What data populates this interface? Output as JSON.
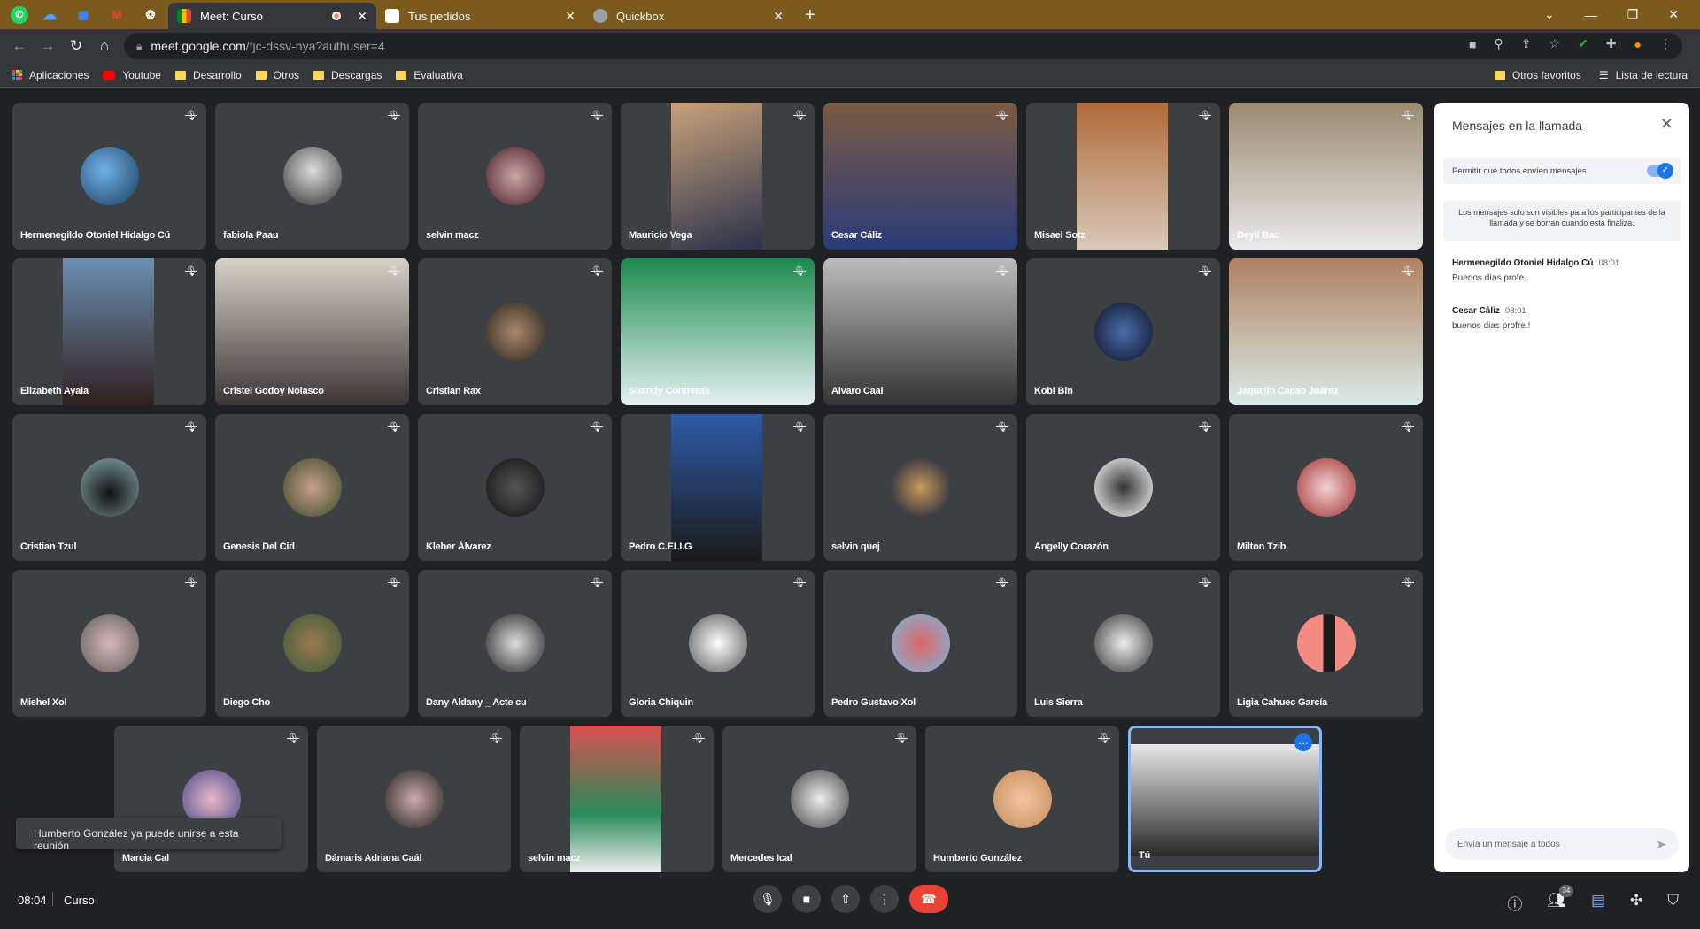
{
  "browser": {
    "tabs": [
      {
        "label": "Meet: Curso",
        "active": true,
        "recording": true
      },
      {
        "label": "Tus pedidos",
        "active": false
      },
      {
        "label": "Quickbox",
        "active": false
      }
    ],
    "url_host": "meet.google.com",
    "url_path": "/fjc-dssv-nya?authuser=4",
    "bookmarks": [
      "Aplicaciones",
      "Youtube",
      "Desarrollo",
      "Otros",
      "Descargas",
      "Evaluativa"
    ],
    "bookmarks_right": [
      "Otros favoritos",
      "Lista de lectura"
    ]
  },
  "participants": [
    "Hermenegildo Otoniel Hidalgo Cú",
    "fabiola Paau",
    "selvin macz",
    "Mauricio Vega",
    "Cesar Cáliz",
    "Misael Sotz",
    "Deyli Bac",
    "Elizabeth Ayala",
    "Cristel Godoy Nolasco",
    "Cristian Rax",
    "Suandy Contreras",
    "Alvaro Caal",
    "Kobi Bin",
    "Jaquelin Cacao Juárez",
    "Cristian Tzul",
    "Genesis Del Cid",
    "Kleber Álvarez",
    "Pedro C.ELI.G",
    "selvin quej",
    "Angelly Corazón",
    "Milton Tzib",
    "Mishel Xol",
    "Diego Cho",
    "Dany Aldany _ Acte cu",
    "Gloria Chiquin",
    "Pedro Gustavo Xol",
    "Luis Sierra",
    "Ligia Cahuec García",
    "Marcia Cal",
    "Dámaris Adriana Caál",
    "selvin macz",
    "Mercedes Ical",
    "Humberto González",
    "Tú"
  ],
  "toast": "Humberto González ya puede unirse a esta reunión",
  "chat": {
    "title": "Mensajes en la llamada",
    "toggle_label": "Permitir que todos envíen mensajes",
    "toggle_on": true,
    "info": "Los mensajes solo son visibles para los participantes de la llamada y se borran cuando esta finaliza.",
    "messages": [
      {
        "sender": "Hermenegildo Otoniel Hidalgo Cú",
        "time": "08:01",
        "text": "Buenos días profe."
      },
      {
        "sender": "Cesar Cáliz",
        "time": "08:01",
        "text": "buenos dias profre.!"
      }
    ],
    "input_placeholder": "Envía un mensaje a todos"
  },
  "bottom": {
    "time": "08:04",
    "meeting_title": "Curso",
    "participant_count": "34"
  },
  "colors": {
    "end_call": "#ea4335",
    "accent": "#1a73e8",
    "tab_bar": "#7a5a1d"
  }
}
